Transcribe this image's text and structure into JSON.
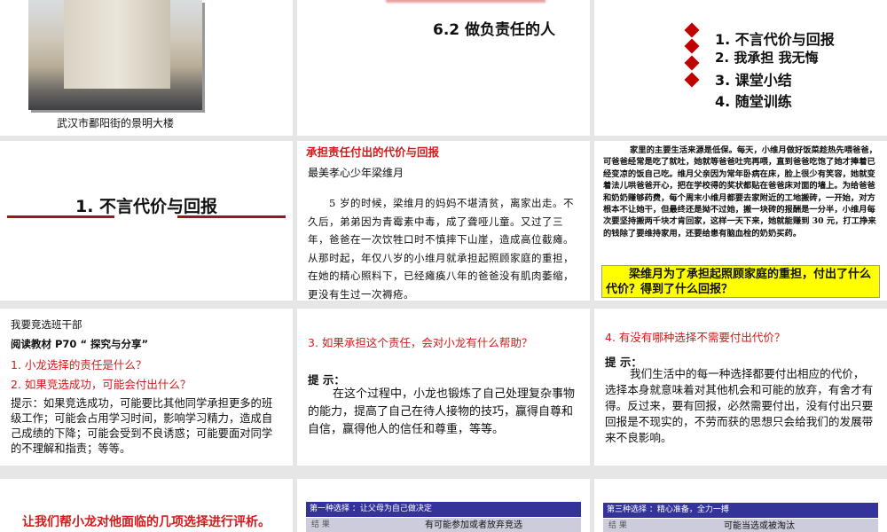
{
  "slides": [
    {
      "caption": "武汉市鄱阳街的景明大楼"
    },
    {
      "title": "6.2  做负责任的人"
    },
    {
      "items": [
        "1. 不言代价与回报",
        "2. 我承担 我无悔",
        "3. 课堂小结",
        "4. 随堂训练"
      ]
    },
    {
      "title": "1. 不言代价与回报"
    },
    {
      "heading": "承担责任付出的代价与回报",
      "subtitle": "最美孝心少年梁维月",
      "body": "5 岁的时候，梁维月的妈妈不堪清贫，离家出走。不久后，弟弟因为青霉素中毒，成了聋哑儿童。又过了三年，爸爸在一次饮牲口时不慎摔下山崖，造成高位截瘫。从那时起，年仅八岁的小维月就承担起照顾家庭的重担，在她的精心照料下，已经瘫痪八年的爸爸没有肌肉萎缩，更没有生过一次褥疮。"
    },
    {
      "body": "家里的主要生活来源是低保。每天，小维月做好饭菜趁热先喂爸爸，可爸爸经常是吃了就吐，她就等爸爸吐完再喂，直到爸爸吃饱了她才捧着已经变凉的饭自己吃。维月父亲因为常年卧病在床，脸上很少有笑容，她就变着法儿哄爸爸开心，把在学校得的奖状都贴在爸爸床对面的墙上。为给爸爸和奶奶赚够药费，每个周末小维月都要去家附近的工地搬砖，一开始，对方根本不让她干，但最终还是拗不过她，搬一块砖的报酬是一分半，小维月每次要坚持搬两千块才肯回家，这样一天下来，她就能赚到 30 元，打工挣来的钱除了要维持家用，还要给患有脑血栓的奶奶买药。",
      "question": "梁维月为了承担起照顾家庭的重担，付出了什么代价？得到了什么回报？"
    },
    {
      "title": "我要竞选班干部",
      "read": "阅读教材 P70 “ 探究与分享”",
      "q1": "1. 小龙选择的责任是什么？",
      "q2": "2. 如果竞选成功，可能会付出什么？",
      "hint": "提示：如果竞选成功，可能要比其他同学承担更多的班级工作；可能会占用学习时间，影响学习精力，造成自己成绩的下降；可能会受到不良诱惑；可能要面对同学的不理解和指责；等等。"
    },
    {
      "question": "3. 如果承担这个责任，会对小龙有什么帮助？",
      "hint_label": "提  示：",
      "hint": "在这个过程中，小龙也锻炼了自己处理复杂事物的能力，提高了自己在待人接物的技巧，赢得自尊和自信，赢得他人的信任和尊重，等等。"
    },
    {
      "question": "4. 有没有哪种选择不需要付出代价？",
      "hint_label": "提  示：",
      "hint": "我们生活中的每一种选择都要付出相应的代价，选择本身就意味着对其他机会和可能的放弃，有舍才有得。反过来，要有回报，必然需要付出，没有付出只要回报是不现实的，不劳而获的思想只会给我们的发展带来不良影响。"
    },
    {
      "title": "让我们帮小龙对他面临的几项选择进行评析。"
    },
    {
      "header": "第一种选择 ：让父母为自己做决定",
      "row_label": "结 果",
      "row_value": "有可能参加或者放弃竞选"
    },
    {
      "header": "第三种选择 ：精心准备，全力一搏",
      "row_label": "结 果",
      "row_value": "可能当选或被淘汰"
    }
  ],
  "colors": {
    "accent_red": "#d21b1b",
    "diamond": "#c00000",
    "table_header": "#333399",
    "highlight": "#ffff00"
  }
}
